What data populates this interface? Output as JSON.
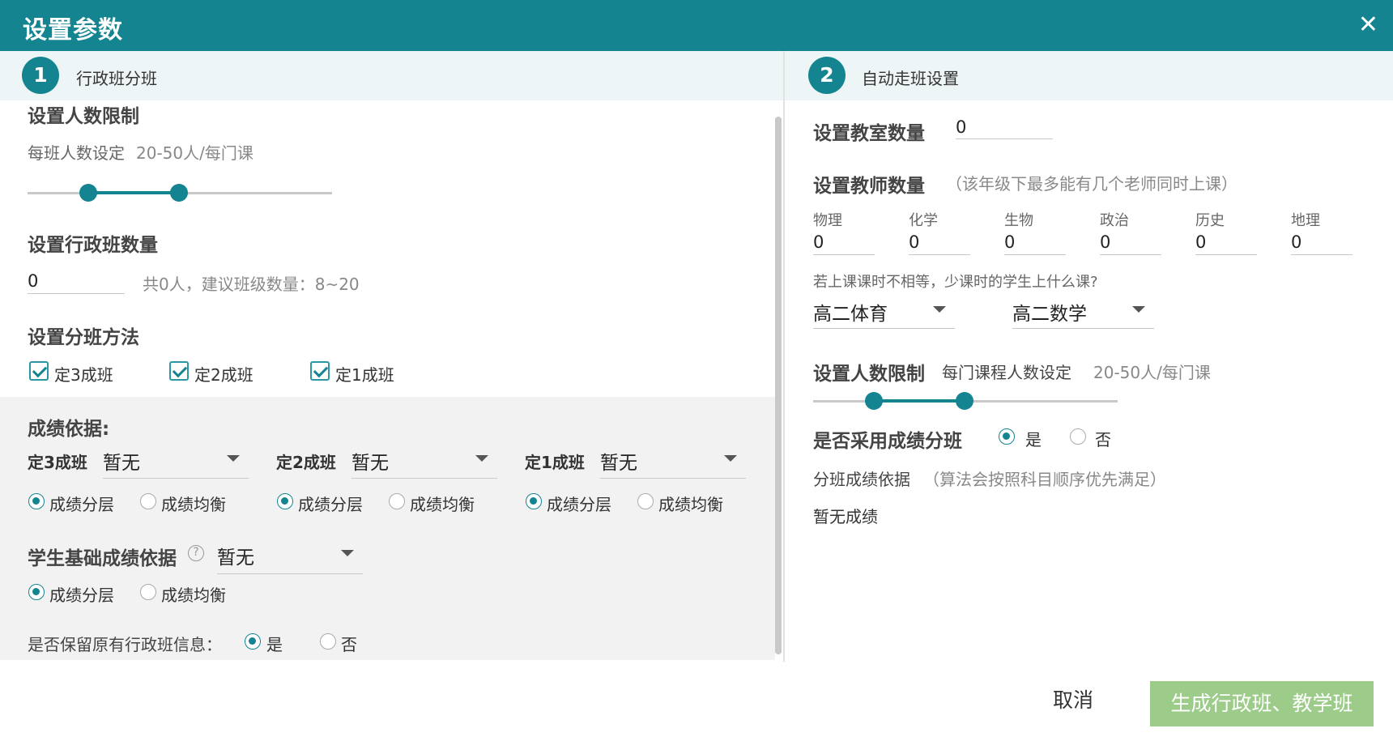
{
  "dialog": {
    "title": "设置参数",
    "close_icon": "close-icon"
  },
  "steps": [
    {
      "num": "1",
      "label": "行政班分班"
    },
    {
      "num": "2",
      "label": "自动走班设置"
    }
  ],
  "left": {
    "people_limit": {
      "title": "设置人数限制",
      "desc_prefix": "每班人数设定",
      "range_text": "20-50人/每门课",
      "range_min": 20,
      "range_max": 50
    },
    "class_count": {
      "title": "设置行政班数量",
      "value": "0",
      "hint": "共0人，建议班级数量：8~20"
    },
    "method": {
      "title": "设置分班方法",
      "options": [
        {
          "label": "定3成班",
          "checked": true
        },
        {
          "label": "定2成班",
          "checked": true
        },
        {
          "label": "定1成班",
          "checked": true
        }
      ]
    },
    "score_basis": {
      "title": "成绩依据:",
      "groups": [
        {
          "name": "定3成班",
          "select": "暂无",
          "radios": [
            "成绩分层",
            "成绩均衡"
          ],
          "selected": 0
        },
        {
          "name": "定2成班",
          "select": "暂无",
          "radios": [
            "成绩分层",
            "成绩均衡"
          ],
          "selected": 0
        },
        {
          "name": "定1成班",
          "select": "暂无",
          "radios": [
            "成绩分层",
            "成绩均衡"
          ],
          "selected": 0
        }
      ]
    },
    "student_basis": {
      "title": "学生基础成绩依据",
      "help_icon": "question-circle-icon",
      "select": "暂无",
      "radios": [
        "成绩分层",
        "成绩均衡"
      ],
      "selected": 0
    },
    "keep_info": {
      "label": "是否保留原有行政班信息：",
      "yes": "是",
      "no": "否",
      "selected": "yes"
    }
  },
  "right": {
    "classroom_count": {
      "title": "设置教室数量",
      "value": "0"
    },
    "teacher_count": {
      "title": "设置教师数量",
      "hint": "（该年级下最多能有几个老师同时上课）",
      "subjects": [
        {
          "name": "物理",
          "value": "0"
        },
        {
          "name": "化学",
          "value": "0"
        },
        {
          "name": "生物",
          "value": "0"
        },
        {
          "name": "政治",
          "value": "0"
        },
        {
          "name": "历史",
          "value": "0"
        },
        {
          "name": "地理",
          "value": "0"
        }
      ]
    },
    "unequal_hours": {
      "question": "若上课课时不相等，少课时的学生上什么课?",
      "select1": "高二体育",
      "select2": "高二数学"
    },
    "people_limit": {
      "title": "设置人数限制",
      "desc_prefix": "每门课程人数设定",
      "range_text": "20-50人/每门课",
      "range_min": 20,
      "range_max": 50
    },
    "use_score": {
      "title": "是否采用成绩分班",
      "yes": "是",
      "no": "否",
      "selected": "yes"
    },
    "score_basis": {
      "label": "分班成绩依据",
      "hint": "（算法会按照科目顺序优先满足）",
      "value": "暂无成绩"
    }
  },
  "footer": {
    "cancel": "取消",
    "submit": "生成行政班、教学班"
  },
  "colors": {
    "primary": "#138490",
    "submit_bg": "#9ccb8a",
    "panel_grey": "#f2f2f2",
    "step_bar": "#eef5f7"
  }
}
